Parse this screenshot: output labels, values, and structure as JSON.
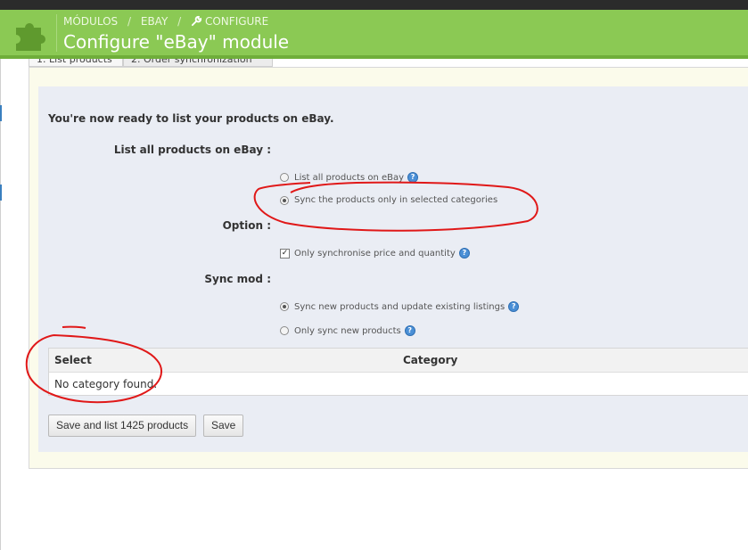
{
  "header": {
    "breadcrumb": [
      "MÓDULOS",
      "EBAY",
      "CONFIGURE"
    ],
    "breadcrumb_separator": "/",
    "title": "Configure \"eBay\" module"
  },
  "tabs": [
    {
      "label": "1. List products"
    },
    {
      "label": "2. Order synchronization"
    }
  ],
  "form": {
    "intro": "You're now ready to list your products on eBay.",
    "list_all_label": "List all products on eBay :",
    "list_options": [
      {
        "label": "List all products on eBay",
        "selected": false,
        "help": true
      },
      {
        "label": "Sync the products only in selected categories",
        "selected": true,
        "help": false
      }
    ],
    "option_label": "Option :",
    "option_checkbox": {
      "label": "Only synchronise price and quantity",
      "checked": true
    },
    "sync_mod_label": "Sync mod :",
    "sync_options": [
      {
        "label": "Sync new products and update existing listings",
        "selected": true
      },
      {
        "label": "Only sync new products",
        "selected": false
      }
    ]
  },
  "table": {
    "headers": [
      "Select",
      "Category"
    ],
    "empty_message": "No category found."
  },
  "buttons": {
    "save_and_list": "Save and list 1425 products",
    "save": "Save"
  },
  "colors": {
    "header_green": "#8bc954",
    "form_bg": "#eaedf4",
    "panel_bg": "#fbfbeb",
    "annotation_red": "#e01818",
    "help_blue": "#4a8fd6"
  }
}
